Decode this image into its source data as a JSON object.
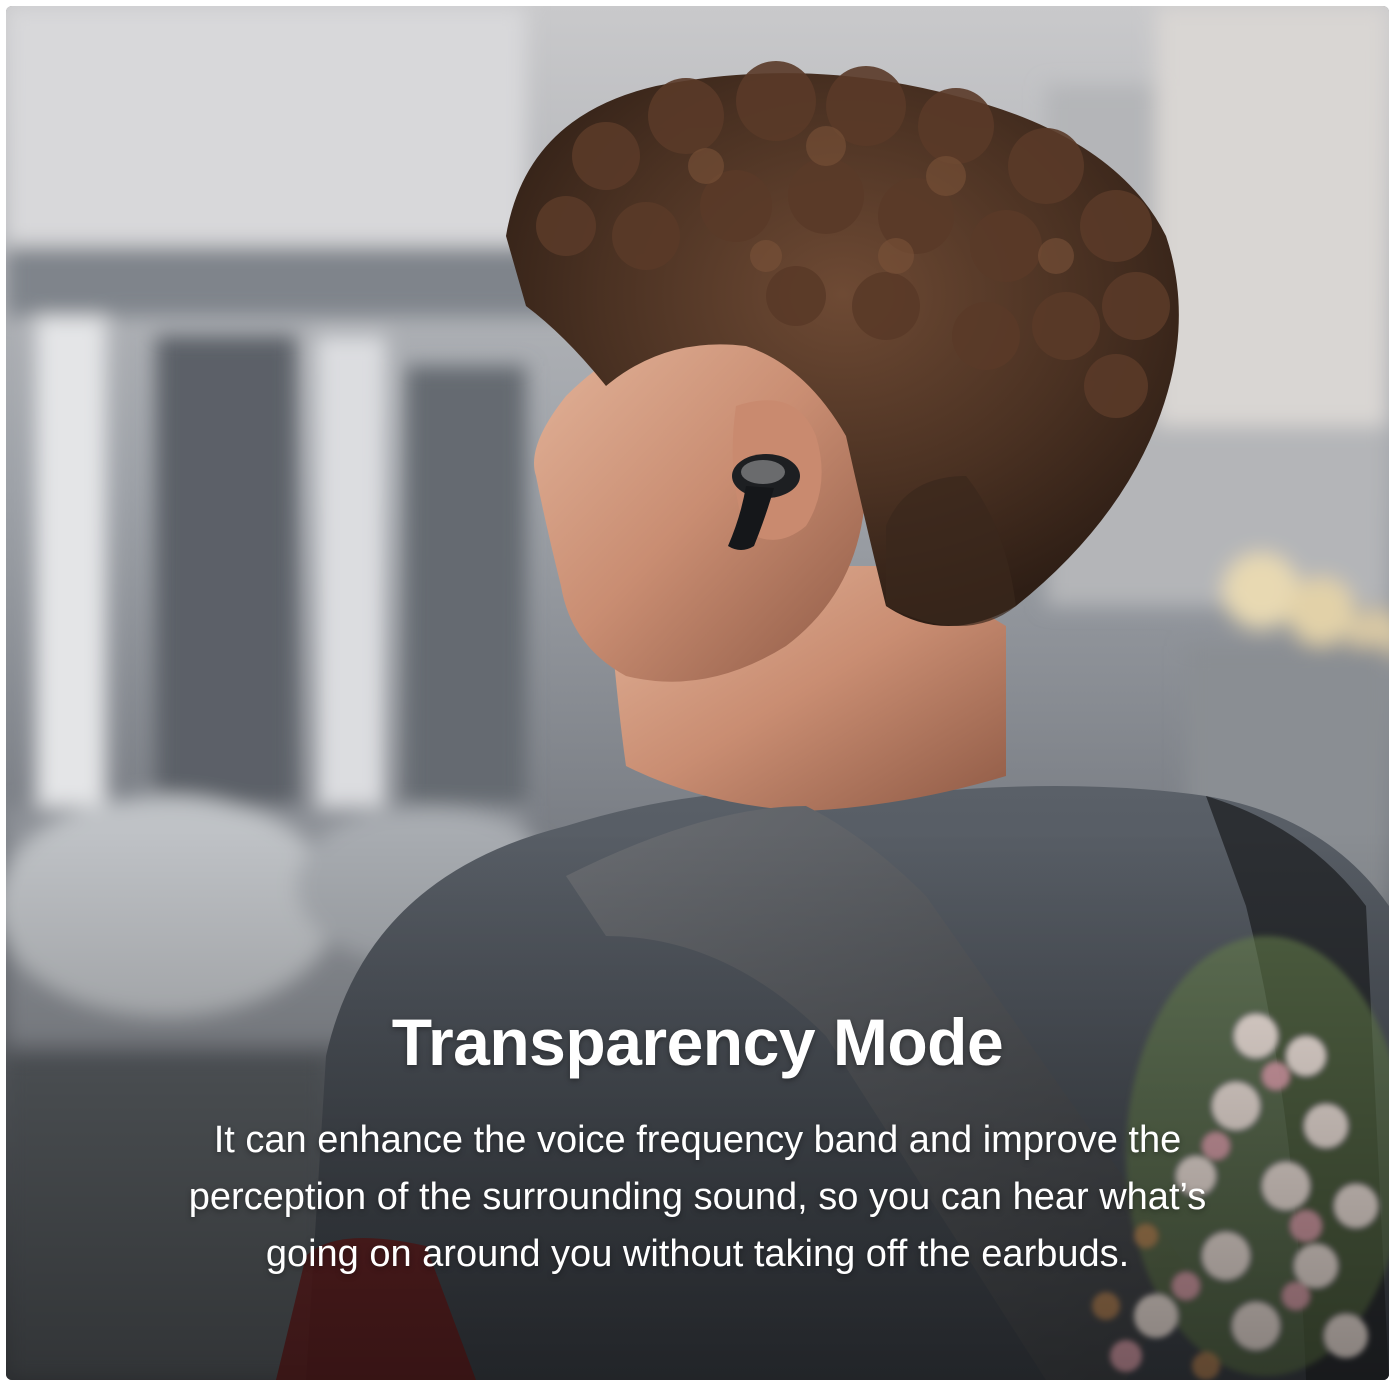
{
  "headline": "Transparency Mode",
  "body_lines": [
    "It can enhance the voice frequency band and improve the",
    "perception of the surrounding sound, so you can hear what’s",
    "going on around you without taking off the earbuds."
  ],
  "colors": {
    "text": "#ffffff",
    "frame": "#ffffff"
  }
}
